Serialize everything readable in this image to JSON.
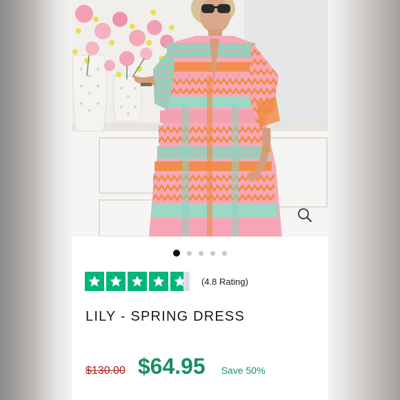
{
  "product": {
    "title": "LILY - SPRING DRESS",
    "image_alt": "Model wearing pink and mint patterned tiered boho dress",
    "gallery": {
      "total": 5,
      "active_index": 0
    },
    "rating": {
      "stars": 5,
      "filled": 4.8,
      "text": "(4.8 Rating)",
      "color": "#00b67a"
    },
    "price": {
      "original": "$130.00",
      "current": "$64.95",
      "save_text": "Save 50%",
      "original_color": "#b0201a",
      "current_color": "#1a8f5f"
    }
  },
  "icons": {
    "zoom": "magnifier-icon",
    "star": "star-icon"
  }
}
